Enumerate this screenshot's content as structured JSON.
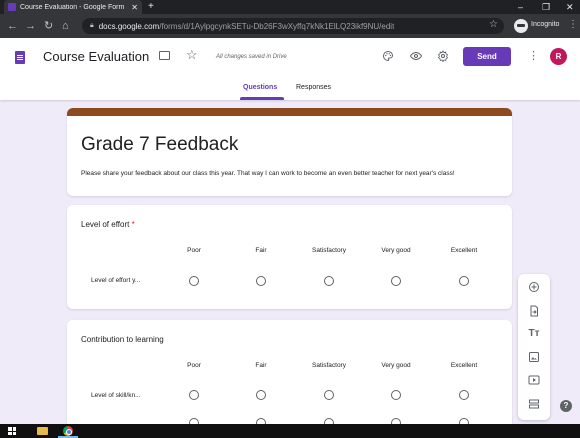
{
  "browser": {
    "tab_title": "Course Evaluation - Google Form",
    "tab_close": "✕",
    "new_tab": "+",
    "url_host": "docs.google.com",
    "url_path": "/forms/d/1AylpgcynkSETu-Db26F3wXyffq7kNk1ElLQ23ikf9NU/edit",
    "incognito_label": "Incognito",
    "window_controls": [
      "–",
      "❐",
      "✕"
    ]
  },
  "forms_header": {
    "title": "Course Evaluation",
    "saved_status": "All changes saved in Drive",
    "send_label": "Send",
    "avatar_letter": "R",
    "tabs": [
      {
        "label": "Questions",
        "active": true
      },
      {
        "label": "Responses",
        "active": false
      }
    ],
    "accent_color": "#673ab7"
  },
  "form": {
    "title": "Grade 7 Feedback",
    "description": "Please share your feedback about our class this year. That way I can work to become an even better teacher for next year's class!",
    "theme_color": "#8c4a1e",
    "questions": [
      {
        "title": "Level of effort",
        "required_mark": "*",
        "columns": [
          "Poor",
          "Fair",
          "Satisfactory",
          "Very good",
          "Excellent"
        ],
        "rows": [
          "Level of effort y..."
        ]
      },
      {
        "title": "Contribution to learning",
        "required_mark": "",
        "columns": [
          "Poor",
          "Fair",
          "Satisfactory",
          "Very good",
          "Excellent"
        ],
        "rows": [
          "Level of skill/kn..."
        ]
      }
    ]
  },
  "side_toolbar": {
    "icons": [
      "add-question-icon",
      "import-questions-icon",
      "add-title-icon",
      "add-image-icon",
      "add-video-icon",
      "add-section-icon"
    ],
    "title_glyph": "Tт"
  },
  "help_label": "?"
}
